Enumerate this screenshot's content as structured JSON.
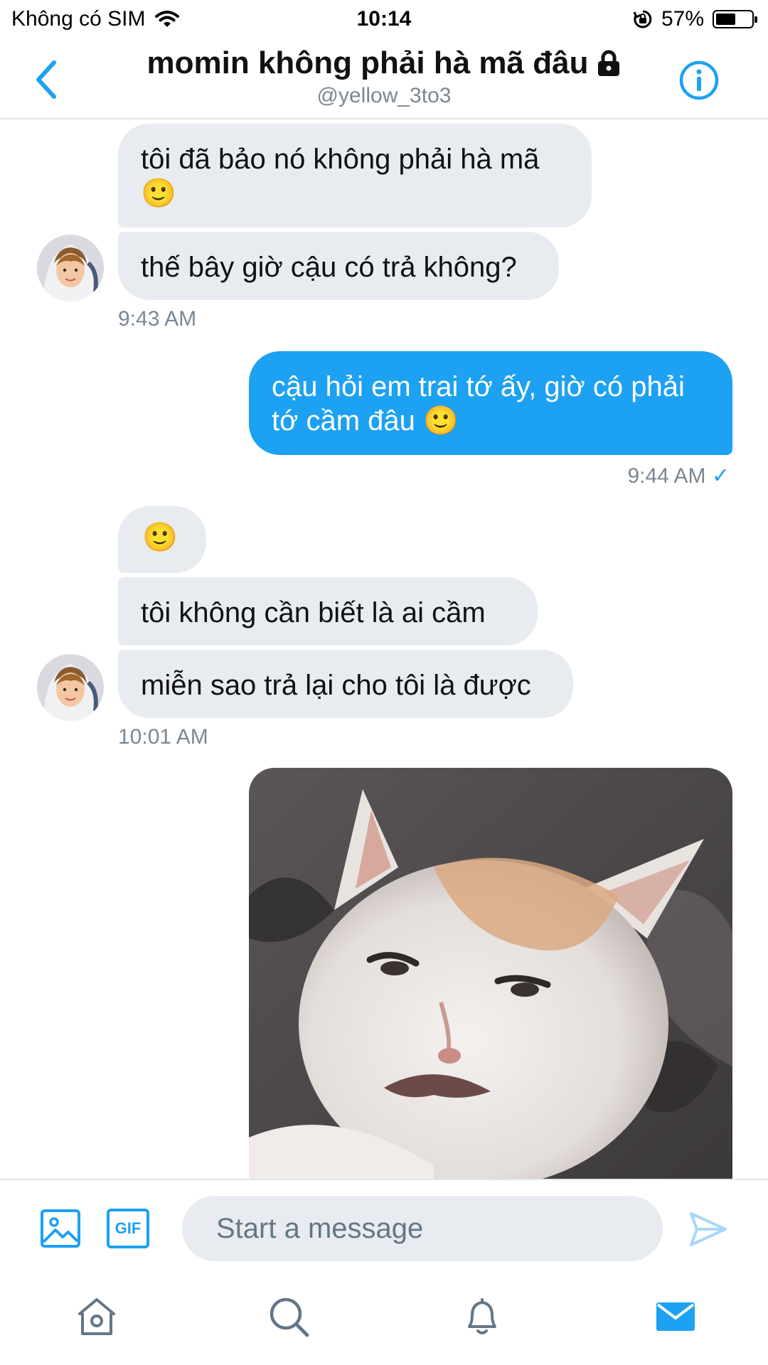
{
  "status_bar": {
    "carrier": "Không có SIM",
    "time": "10:14",
    "battery_percent": "57%",
    "battery_level": 0.57
  },
  "header": {
    "title": "momin không phải hà mã đâu",
    "handle": "@yellow_3to3"
  },
  "messages": {
    "m1_line1": "tôi đã bảo nó không phải hà mã",
    "m1_emoji": "🙂",
    "m2": "thế bây giờ cậu có trả không?",
    "ts1": "9:43 AM",
    "m3_line1": "cậu hỏi em trai tớ ấy, giờ có phải",
    "m3_line2": "tớ cầm đâu",
    "m3_emoji": "🙂",
    "ts2": "9:44 AM",
    "ts2_check": "✓",
    "m4_emoji": "🙂",
    "m5": "tôi không cần biết là ai cầm",
    "m6": "miễn sao trả lại cho tôi là được",
    "ts3": "10:01 AM"
  },
  "composer": {
    "placeholder": "Start a message",
    "gif_label": "GIF"
  },
  "colors": {
    "accent": "#1da1f2",
    "incoming_bubble": "#e8ecf0",
    "muted_text": "#7b8792"
  },
  "icons": {
    "back": "chevron-left-icon",
    "info": "info-icon",
    "lock": "lock-icon",
    "image": "image-icon",
    "gif": "gif-icon",
    "send": "send-icon",
    "home": "home-icon",
    "search": "search-icon",
    "notifications": "bell-icon",
    "messages": "mail-icon"
  }
}
